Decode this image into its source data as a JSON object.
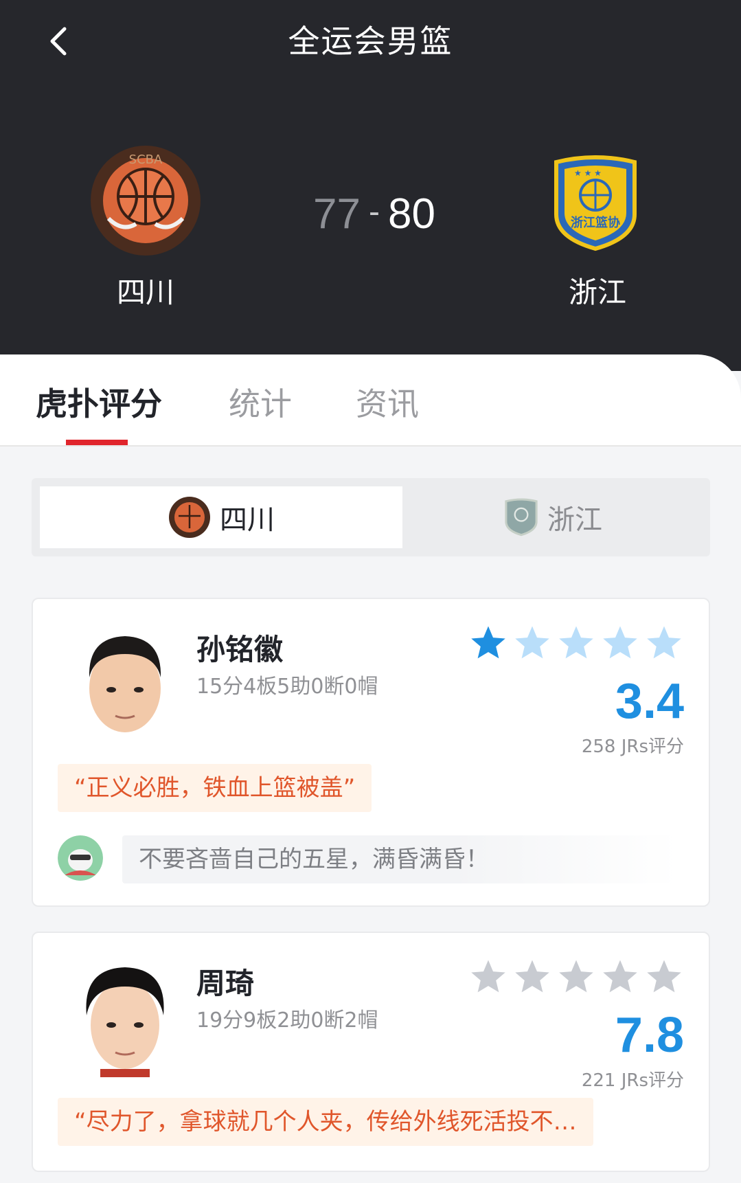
{
  "header": {
    "title": "全运会男篮",
    "home": {
      "name": "四川",
      "score": "77",
      "logo_text": "SCBA"
    },
    "away": {
      "name": "浙江",
      "score": "80",
      "logo_text": "浙江篮协"
    },
    "score_separator": "-"
  },
  "tabs": [
    {
      "label": "虎扑评分",
      "active": true
    },
    {
      "label": "统计",
      "active": false
    },
    {
      "label": "资讯",
      "active": false
    }
  ],
  "team_switcher": {
    "home_label": "四川",
    "away_label": "浙江",
    "selected": "四川"
  },
  "players": [
    {
      "name": "孙铭徽",
      "stats": "15分4板5助0断0帽",
      "stars": 1,
      "rating": "3.4",
      "votes": "258 JRs评分",
      "quote": "“正义必胜，铁血上篮被盖”",
      "top_comment": "不要吝啬自己的五星，满昏满昏！"
    },
    {
      "name": "周琦",
      "stats": "19分9板2助0断2帽",
      "stars": 0,
      "rating": "7.8",
      "votes": "221 JRs评分",
      "quote": "“尽力了，拿球就几个人夹，传给外线死活投不…"
    }
  ],
  "colors": {
    "header_bg": "#26272c",
    "accent_red": "#e0252c",
    "rating_blue": "#1f8fe0",
    "star_active": "#1f8fe0",
    "star_inactive_1": "#b9defa",
    "star_inactive_2": "#c8cbd1",
    "quote_text": "#e0562b",
    "quote_bg": "#fff3e8"
  },
  "icons": {
    "back": "chevron-left-icon",
    "star": "star-icon"
  }
}
